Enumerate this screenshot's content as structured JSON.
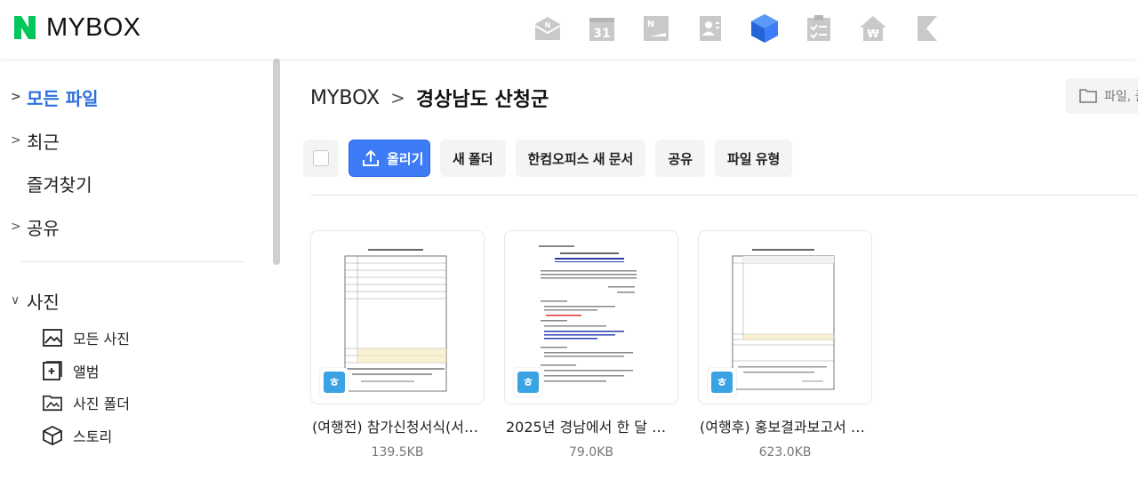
{
  "header": {
    "logo_text": "MYBOX",
    "logo_color": "#03c75a",
    "apps": [
      {
        "name": "mail-icon",
        "label": "N"
      },
      {
        "name": "calendar-icon",
        "label": "31"
      },
      {
        "name": "memo-icon",
        "label": "N"
      },
      {
        "name": "contacts-icon",
        "label": ""
      },
      {
        "name": "mybox-icon",
        "label": ""
      },
      {
        "name": "todo-icon",
        "label": ""
      },
      {
        "name": "household-icon",
        "label": "₩"
      },
      {
        "name": "bookmark-icon",
        "label": ""
      }
    ]
  },
  "sidebar": {
    "items": [
      {
        "label": "모든 파일",
        "active": true
      },
      {
        "label": "최근"
      },
      {
        "label": "즐겨찾기"
      },
      {
        "label": "공유"
      }
    ],
    "photo_section": {
      "label": "사진"
    },
    "photo_items": [
      {
        "label": "모든 사진",
        "icon": "image-icon"
      },
      {
        "label": "앨범",
        "icon": "album-icon"
      },
      {
        "label": "사진 폴더",
        "icon": "photo-folder-icon"
      },
      {
        "label": "스토리",
        "icon": "story-icon"
      }
    ]
  },
  "main": {
    "breadcrumb": {
      "root": "MYBOX",
      "current": "경상남도 산청군"
    },
    "search": {
      "placeholder": "파일, 폴더 검색"
    },
    "toolbar": {
      "upload": "올리기",
      "new_folder": "새 폴더",
      "hancom_new_doc": "한컴오피스 새 문서",
      "share": "공유",
      "file_type": "파일 유형"
    },
    "files": [
      {
        "name": "(여행전) 참가신청서식(서…",
        "size": "139.5KB",
        "badge": "ㅎ"
      },
      {
        "name": "2025년 경남에서 한 달 여…",
        "size": "79.0KB",
        "badge": "ㅎ"
      },
      {
        "name": "(여행후) 홍보결과보고서 및…",
        "size": "623.0KB",
        "badge": "ㅎ"
      }
    ]
  },
  "colors": {
    "accent": "#3d7bf7",
    "active_nav": "#2e6fdc",
    "hancom_badge": "#3aa3e3"
  }
}
